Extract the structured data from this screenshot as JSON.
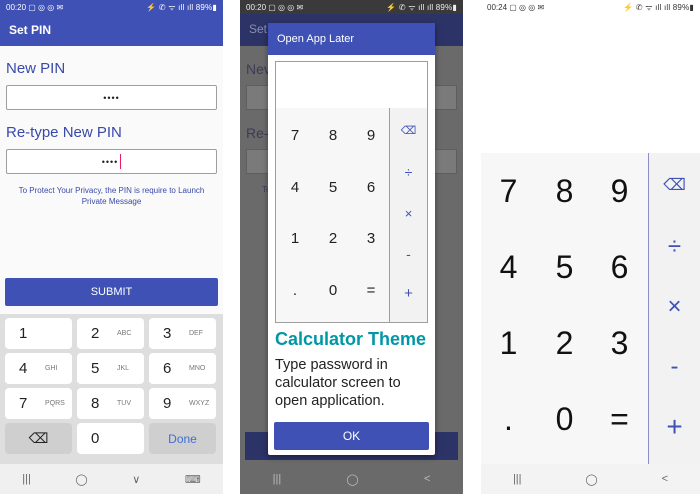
{
  "screen1": {
    "status": {
      "time": "00:20",
      "icons_left": "▢ ◎ ◎ ✉",
      "right": "⚡ ✆ ᯤ ıll ıll 89%▮"
    },
    "title": "Set PIN",
    "new_pin_label": "New PIN",
    "new_pin_value": "••••",
    "retype_label": "Re-type New PIN",
    "retype_value": "••••",
    "privacy_text": "To Protect Your Privacy, the PIN is require to Launch Private Message",
    "submit_label": "SUBMIT",
    "keyboard": {
      "rows": [
        [
          {
            "d": "1",
            "l": ""
          },
          {
            "d": "2",
            "l": "ABC"
          },
          {
            "d": "3",
            "l": "DEF"
          }
        ],
        [
          {
            "d": "4",
            "l": "GHI"
          },
          {
            "d": "5",
            "l": "JKL"
          },
          {
            "d": "6",
            "l": "MNO"
          }
        ],
        [
          {
            "d": "7",
            "l": "PQRS"
          },
          {
            "d": "8",
            "l": "TUV"
          },
          {
            "d": "9",
            "l": "WXYZ"
          }
        ]
      ],
      "zero": "0",
      "backspace_icon": "⌫",
      "done_label": "Done"
    },
    "nav": {
      "recent": "|||",
      "home": "◯",
      "back": "∨",
      "keyboard": "⌨"
    }
  },
  "screen2": {
    "status": {
      "time": "00:20",
      "icons_left": "▢ ◎ ◎ ✉",
      "right": "⚡ ✆ ᯤ ıll ıll 89%▮"
    },
    "dialog": {
      "title": "Open App Later",
      "calc_keys": [
        "7",
        "8",
        "9",
        "4",
        "5",
        "6",
        "1",
        "2",
        "3",
        ".",
        "0",
        "="
      ],
      "calc_ops": [
        "⌫",
        "÷",
        "×",
        "-",
        "+"
      ],
      "theme_title": "Calculator Theme",
      "description": "Type password in calculator screen to open application.",
      "ok_label": "OK"
    },
    "background_fragments": {
      "title": "Set",
      "label1": "Nev",
      "label2": "Re-",
      "privacy": "To"
    },
    "nav": {
      "recent": "|||",
      "home": "◯",
      "back": "<"
    }
  },
  "screen3": {
    "status": {
      "time": "00:24",
      "icons_left": "▢ ◎ ◎ ✉",
      "right": "⚡ ✆ ᯤ ıll ıll 89%▮"
    },
    "calc_keys": [
      "7",
      "8",
      "9",
      "4",
      "5",
      "6",
      "1",
      "2",
      "3",
      ".",
      "0",
      "="
    ],
    "calc_ops": [
      "⌫",
      "÷",
      "×",
      "-",
      "+"
    ],
    "nav": {
      "recent": "|||",
      "home": "◯",
      "back": "<"
    }
  },
  "colors": {
    "primary": "#3f51b5",
    "accent_teal": "#0097a7",
    "caret": "#e91e63"
  }
}
